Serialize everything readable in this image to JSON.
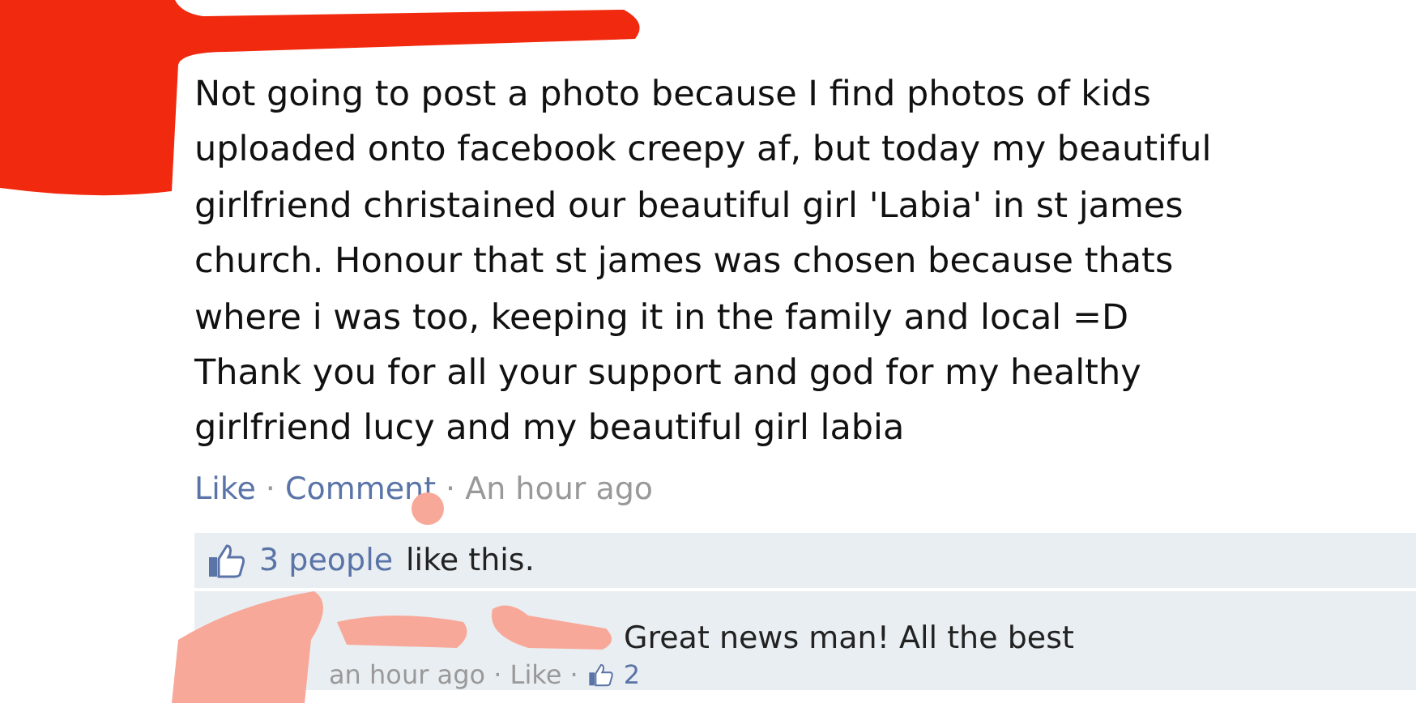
{
  "post": {
    "body": "Not going to post a photo because I find photos of kids\nuploaded onto facebook creepy af, but today my beautiful\ngirlfriend christained our beautiful girl 'Labia' in st james\nchurch. Honour that st james was chosen because thats\nwhere i was too, keeping it in the family and local =D\nThank you for all your support and god for my healthy\ngirlfriend lucy and my beautiful girl labia",
    "actions": [
      {
        "label": "Like",
        "kind": "link"
      },
      {
        "label": "·",
        "kind": "separator"
      },
      {
        "label": "Comment",
        "kind": "link"
      },
      {
        "label": "·",
        "kind": "separator"
      },
      {
        "label": "An hour ago",
        "kind": "time"
      }
    ]
  },
  "likes": {
    "count_link": "3 people",
    "text": "like this."
  },
  "comments": [
    {
      "text": "Great news man! All the best",
      "meta": "an hour ago · Like ·",
      "like_count": "2"
    }
  ]
}
